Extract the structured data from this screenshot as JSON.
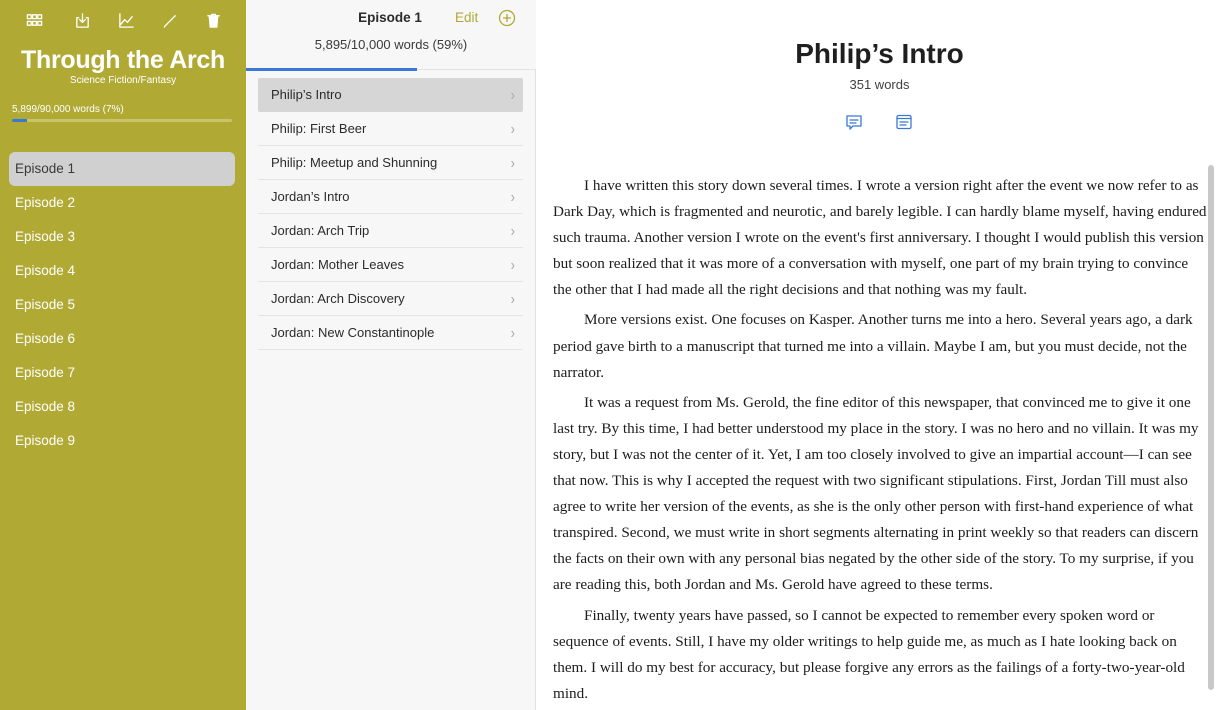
{
  "toolbar": {
    "icons": [
      "grid-icon",
      "export-icon",
      "stats-icon",
      "pencil-icon",
      "trash-icon"
    ]
  },
  "project": {
    "title": "Through the Arch",
    "genre": "Science Fiction/Fantasy",
    "words": "5,899/90,000 words (7%)",
    "progress": 0.07
  },
  "episodes": [
    {
      "label": "Episode 1",
      "selected": true
    },
    {
      "label": "Episode 2"
    },
    {
      "label": "Episode 3"
    },
    {
      "label": "Episode 4"
    },
    {
      "label": "Episode 5"
    },
    {
      "label": "Episode 6"
    },
    {
      "label": "Episode 7"
    },
    {
      "label": "Episode 8"
    },
    {
      "label": "Episode 9"
    }
  ],
  "episode_panel": {
    "title": "Episode 1",
    "edit_label": "Edit",
    "words": "5,895/10,000 words (59%)",
    "progress": 0.59,
    "chapters": [
      {
        "label": "Philip’s Intro",
        "selected": true
      },
      {
        "label": "Philip: First Beer"
      },
      {
        "label": "Philip: Meetup and Shunning"
      },
      {
        "label": "Jordan’s Intro"
      },
      {
        "label": "Jordan: Arch Trip"
      },
      {
        "label": "Jordan: Mother Leaves"
      },
      {
        "label": "Jordan: Arch Discovery"
      },
      {
        "label": "Jordan: New Constantinople"
      }
    ],
    "chevron": "›"
  },
  "document": {
    "title": "Philip’s Intro",
    "words": "351 words",
    "paragraphs": [
      "I have written this story down several times. I wrote a version right after the event we now refer to as Dark Day, which is fragmented and neurotic, and barely legible. I can hardly blame myself, having endured such trauma. Another version I wrote on the event's first anniversary. I thought I would publish this version but soon realized that it was more of a conversation with myself, one part of my brain trying to convince the other that I had made all the right decisions and that nothing was my fault.",
      "More versions exist. One focuses on Kasper. Another turns me into a hero. Several years ago, a dark period gave birth to a manuscript that turned me into a villain. Maybe I am, but you must decide, not the narrator.",
      "It was a request from Ms. Gerold, the fine editor of this newspaper, that convinced me to give it one last try. By this time, I had better understood my place in the story. I was no hero and no villain. It was my story, but I was not the center of it. Yet, I am too closely involved to give an impartial account—I can see that now. This is why I accepted the request with two significant stipulations. First, Jordan Till must also agree to write her version of the events, as she is the only other person with first-hand experience of what transpired. Second, we must write in short segments alternating in print weekly so that readers can discern the facts on their own with any personal bias negated by the other side of the story. To my surprise, if you are reading this, both Jordan and Ms. Gerold have agreed to these terms.",
      "Finally, twenty years have passed, so I cannot be expected to remember every spoken word or sequence of events. Still, I have my older writings to help guide me, as much as I hate looking back on them. I will do my best for accuracy, but please forgive any errors as the failings of a forty-two-year-old mind."
    ]
  },
  "colors": {
    "sidebar": "#b0aa35",
    "accent": "#b0aa35",
    "progress": "#3a78d6",
    "icon_blue": "#3a78d6"
  }
}
